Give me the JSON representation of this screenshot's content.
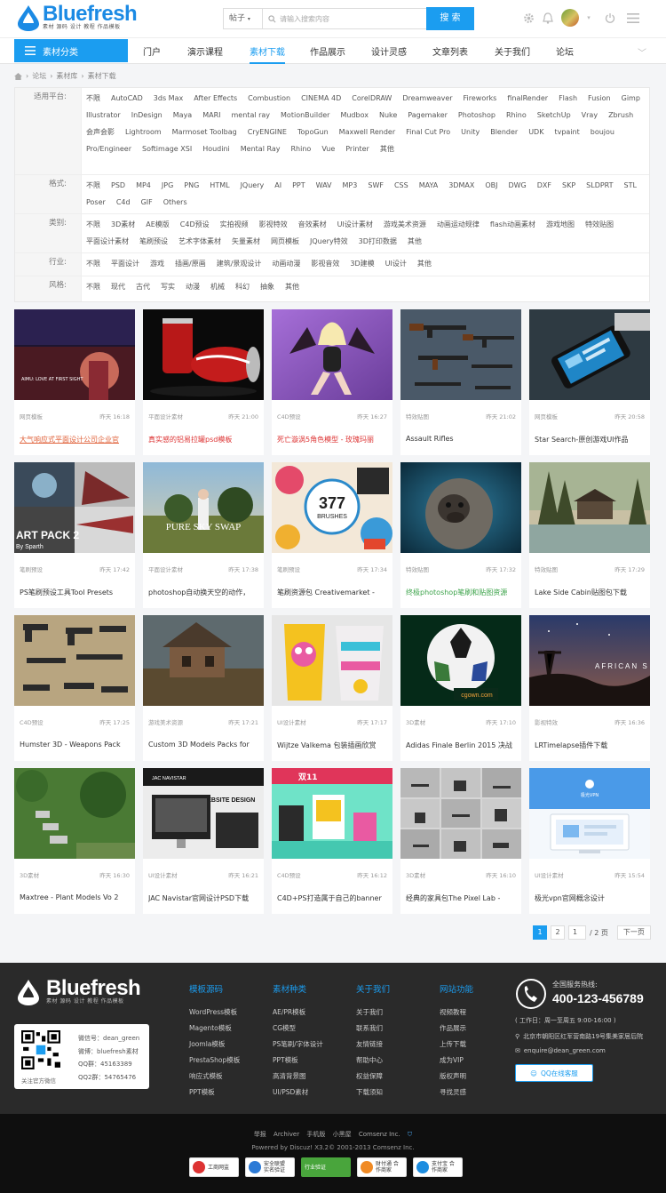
{
  "brand": {
    "name": "Bluefresh",
    "tagline": "素材 源码 设计 教程 作品模板",
    "color": "#1b9df0"
  },
  "search": {
    "scope": "帖子",
    "placeholder": "请输入搜索内容",
    "button": "搜 索"
  },
  "nav": {
    "category_button": "素材分类",
    "items": [
      "门户",
      "演示课程",
      "素材下载",
      "作品展示",
      "设计灵感",
      "文章列表",
      "关于我们",
      "论坛"
    ],
    "active_index": 2
  },
  "breadcrumb": [
    "论坛",
    "素材库",
    "素材下载"
  ],
  "filters": [
    {
      "label": "适用平台:",
      "options": [
        "不限",
        "AutoCAD",
        "3ds Max",
        "After Effects",
        "Combustion",
        "CINEMA 4D",
        "CorelDRAW",
        "Dreamweaver",
        "Fireworks",
        "finalRender",
        "Flash",
        "Fusion",
        "Gimp",
        "Illustrator",
        "InDesign",
        "Maya",
        "MARI",
        "mental ray",
        "MotionBuilder",
        "Mudbox",
        "Nuke",
        "Pagemaker",
        "Photoshop",
        "Rhino",
        "SketchUp",
        "Vray",
        "Zbrush",
        "会声会影",
        "Lightroom",
        "Marmoset Toolbag",
        "CryENGINE",
        "TopoGun",
        "Maxwell Render",
        "Final Cut Pro",
        "Unity",
        "Blender",
        "UDK",
        "tvpaint",
        "boujou",
        "Pro/Engineer",
        "Softimage XSI",
        "Houdini",
        "Mental Ray",
        "Rhino",
        "Vue",
        "Printer",
        "其他"
      ]
    },
    {
      "label": "格式:",
      "options": [
        "不限",
        "PSD",
        "MP4",
        "JPG",
        "PNG",
        "HTML",
        "JQuery",
        "AI",
        "PPT",
        "WAV",
        "MP3",
        "SWF",
        "CSS",
        "MAYA",
        "3DMAX",
        "OBJ",
        "DWG",
        "DXF",
        "SKP",
        "SLDPRT",
        "STL",
        "Poser",
        "C4d",
        "GIF",
        "Others"
      ]
    },
    {
      "label": "类别:",
      "options": [
        "不限",
        "3D素材",
        "AE模版",
        "C4D预设",
        "实拍视频",
        "影视特效",
        "音效素材",
        "UI设计素材",
        "游戏美术资源",
        "动画运动规律",
        "flash动画素材",
        "游戏地图",
        "特效贴图",
        "平面设计素材",
        "笔刷预设",
        "艺术字体素材",
        "矢量素材",
        "网页模板",
        "JQuery特效",
        "3D打印数据",
        "其他"
      ]
    },
    {
      "label": "行业:",
      "options": [
        "不限",
        "平面设计",
        "游戏",
        "插画/原画",
        "建筑/景观设计",
        "动画动漫",
        "影视音效",
        "3D建模",
        "UI设计",
        "其他"
      ]
    },
    {
      "label": "风格:",
      "options": [
        "不限",
        "现代",
        "古代",
        "写实",
        "动漫",
        "机械",
        "科幻",
        "抽象",
        "其他"
      ]
    }
  ],
  "cards": [
    {
      "category": "网页模板",
      "time": "昨天 16:18",
      "title": "大气响应式平面设计公司企业官",
      "style": "orange-ul",
      "thumb": "web1",
      "thumb_text": "AIMU: LOVE AT FIRST SIGHT"
    },
    {
      "category": "平面设计素材",
      "time": "昨天 21:00",
      "title": "真实感的铝易拉罐psd模板",
      "style": "red",
      "thumb": "can",
      "thumb_text": ""
    },
    {
      "category": "C4D预设",
      "time": "昨天 16:27",
      "title": "死亡漩涡5角色模型 - 玫瑰玛丽",
      "style": "red",
      "thumb": "girl",
      "thumb_text": ""
    },
    {
      "category": "特效贴图",
      "time": "昨天 21:02",
      "title": "Assault Rifles",
      "style": "",
      "thumb": "rifles",
      "thumb_text": ""
    },
    {
      "category": "网页模板",
      "time": "昨天 20:58",
      "title": "Star Search-原创游戏UI作品",
      "style": "",
      "thumb": "phone",
      "thumb_text": ""
    },
    {
      "category": "笔刷预设",
      "time": "昨天 17:42",
      "title": "PS笔刷预设工具Tool Presets",
      "style": "",
      "thumb": "artpack",
      "thumb_text": "ART PACK 2",
      "thumb_sub": "By Sparth"
    },
    {
      "category": "平面设计素材",
      "time": "昨天 17:38",
      "title": "photoshop自动换天空的动作，",
      "style": "",
      "thumb": "sky",
      "thumb_text": "PURE SKY SWAP"
    },
    {
      "category": "笔刷预设",
      "time": "昨天 17:34",
      "title": "笔刷资源包 Creativemarket -",
      "style": "",
      "thumb": "brushes",
      "thumb_text": "377",
      "thumb_sub": "BRUSHES"
    },
    {
      "category": "特效贴图",
      "time": "昨天 17:32",
      "title": "终极photoshop笔刷和贴图资源",
      "style": "green",
      "thumb": "gorilla",
      "thumb_text": ""
    },
    {
      "category": "特效贴图",
      "time": "昨天 17:29",
      "title": "Lake Side Cabin贴图包下载",
      "style": "",
      "thumb": "lake",
      "thumb_text": ""
    },
    {
      "category": "C4D预设",
      "time": "昨天 17:25",
      "title": "Humster 3D - Weapons Pack",
      "style": "",
      "thumb": "pistols",
      "thumb_text": ""
    },
    {
      "category": "游戏美术资源",
      "time": "昨天 17:21",
      "title": "Custom 3D Models Packs for",
      "style": "",
      "thumb": "house",
      "thumb_text": ""
    },
    {
      "category": "UI设计素材",
      "time": "昨天 17:17",
      "title": "Wijtze Valkema 包装插画欣赏",
      "style": "",
      "thumb": "cup",
      "thumb_text": ""
    },
    {
      "category": "3D素材",
      "time": "昨天 17:10",
      "title": "Adidas Finale Berlin 2015 决战",
      "style": "",
      "thumb": "ball",
      "thumb_text": "cgown.com"
    },
    {
      "category": "影视特效",
      "time": "昨天 16:36",
      "title": "LRTimelapse插件下载",
      "style": "",
      "thumb": "african",
      "thumb_text": "AFRICAN S"
    },
    {
      "category": "3D素材",
      "time": "昨天 16:30",
      "title": "Maxtree - Plant Models Vo 2",
      "style": "",
      "thumb": "garden",
      "thumb_text": ""
    },
    {
      "category": "UI设计素材",
      "time": "昨天 16:21",
      "title": "JAC Navistar官网设计PSD下载",
      "style": "",
      "thumb": "jac",
      "thumb_text": "WEBSITE DESIGN",
      "thumb_sub": "JAC NAVISTAR"
    },
    {
      "category": "C4D预设",
      "time": "昨天 16:12",
      "title": "C4D+PS打造属于自己的banner",
      "style": "",
      "thumb": "banner",
      "thumb_text": "双11"
    },
    {
      "category": "3D素材",
      "time": "昨天 16:10",
      "title": "经典的家具包The Pixel Lab -",
      "style": "",
      "thumb": "furniture",
      "thumb_text": ""
    },
    {
      "category": "UI设计素材",
      "time": "昨天 15:54",
      "title": "极光vpn官网概念设计",
      "style": "",
      "thumb": "vpn",
      "thumb_text": "极光VPN"
    }
  ],
  "pager": {
    "pages": [
      "1",
      "2"
    ],
    "current": "1",
    "input": "1",
    "total": "/ 2 页",
    "next": "下一页"
  },
  "footer": {
    "columns": [
      {
        "title": "模板源码",
        "links": [
          "WordPress模板",
          "Magento模板",
          "Joomla模板",
          "PrestaShop模板",
          "响应式模板",
          "PPT模板"
        ]
      },
      {
        "title": "素材种类",
        "links": [
          "AE/PR模板",
          "CG模型",
          "PS笔刷/字体设计",
          "PPT模板",
          "高清背景图",
          "UI/PSD素材"
        ]
      },
      {
        "title": "关于我们",
        "links": [
          "关于我们",
          "联系我们",
          "友情链接",
          "帮助中心",
          "权益保障",
          "下载须知"
        ]
      },
      {
        "title": "网站功能",
        "links": [
          "视频教程",
          "作品展示",
          "上传下载",
          "成为VIP",
          "版权声明",
          "寻找灵感"
        ]
      }
    ],
    "qr": {
      "caption": "关注官方微信",
      "info": [
        "微信号：dean_green",
        "微博：bluefresh素材",
        "QQ群：45163389",
        "QQ2群：54765476"
      ]
    },
    "hotline": {
      "label": "全国服务热线:",
      "number": "400-123-456789",
      "hours": "( 工作日：周一至周五 9:00-16:00 )",
      "address": "北京市朝阳区红军营南路19号集美家居后院",
      "email": "enquire@dean_green.com",
      "qq_button": "QQ在线客服"
    }
  },
  "bottom": {
    "links": [
      "举报",
      "Archiver",
      "手机版",
      "小黑屋",
      "Comsenz Inc."
    ],
    "copyright": "Powered by Discuz! X3.2© 2001-2013 Comsenz Inc.",
    "badges": [
      "工商网监",
      "安全联盟 实名验证",
      "行业验证",
      "财付通 合作商家",
      "支付宝 合作商家"
    ]
  }
}
